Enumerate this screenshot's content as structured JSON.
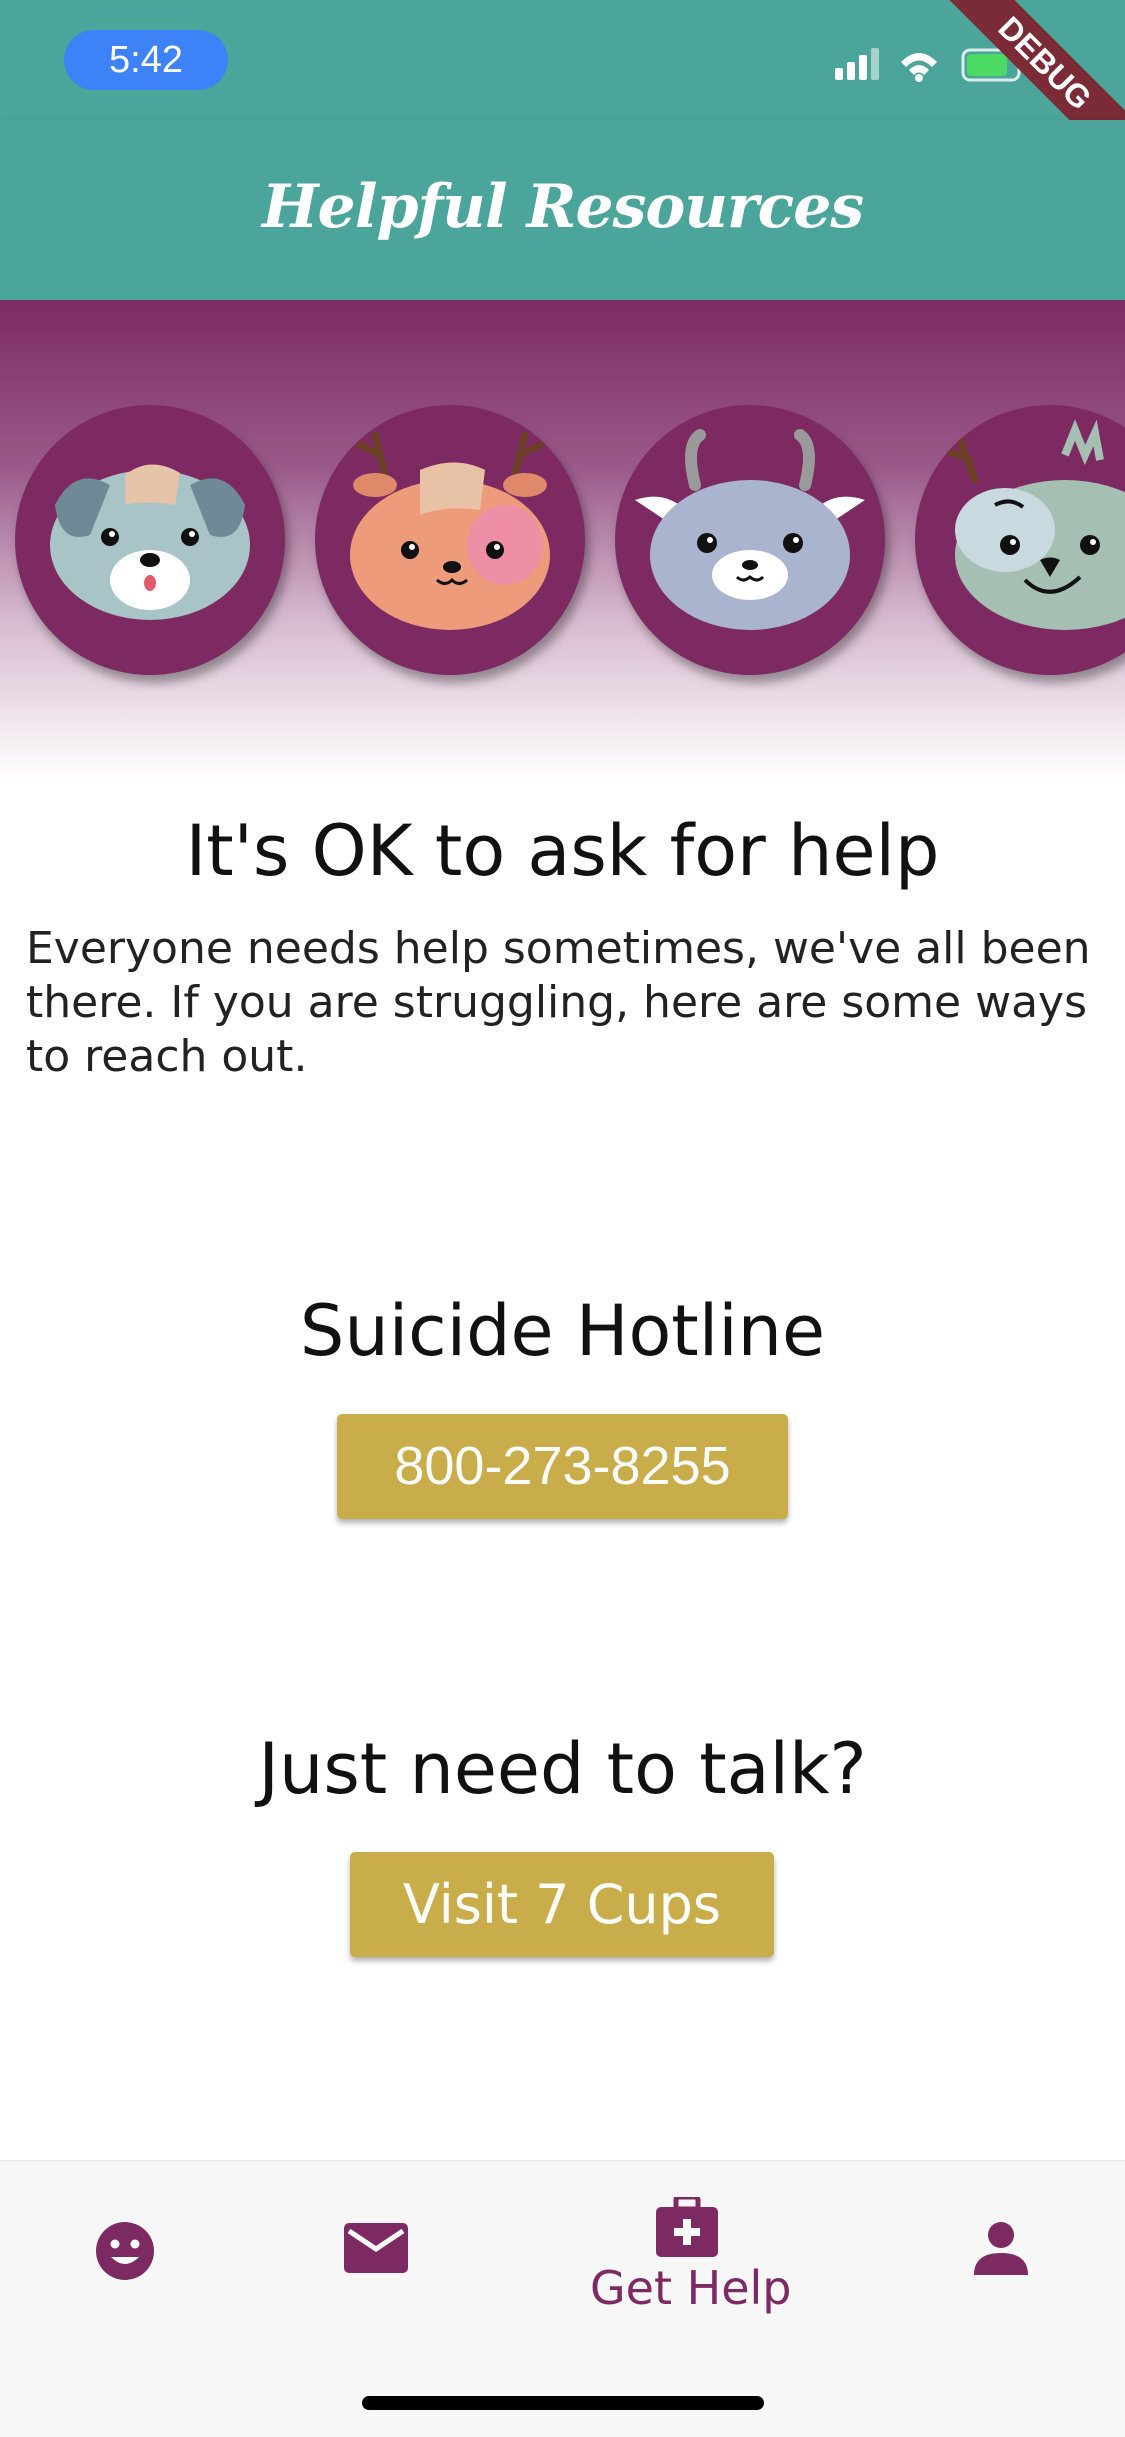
{
  "status_bar": {
    "time": "5:42"
  },
  "debug_banner": "DEBUG",
  "app_bar": {
    "title": "Helpful Resources"
  },
  "avatars": [
    {
      "name": "puppy",
      "face_color": "#a9c4c6"
    },
    {
      "name": "deer",
      "face_color": "#ee9b7b"
    },
    {
      "name": "goat",
      "face_color": "#aab4cf"
    },
    {
      "name": "moose",
      "face_color": "#a5c0b2"
    }
  ],
  "intro": {
    "heading": "It's OK to ask for help",
    "body": "Everyone needs help sometimes, we've all been there. If you are struggling, here are some ways to reach out."
  },
  "hotline": {
    "title": "Suicide Hotline",
    "button": "800-273-8255"
  },
  "talk": {
    "title": "Just need to talk?",
    "button": "Visit 7 Cups"
  },
  "bottom_nav": {
    "items": [
      {
        "icon": "smiley-face-icon"
      },
      {
        "icon": "mail-icon"
      },
      {
        "icon": "medical-kit-icon",
        "label": "Get Help",
        "active": true
      },
      {
        "icon": "person-icon"
      }
    ]
  },
  "colors": {
    "primary_teal": "#4ba59a",
    "brand_purple": "#7d2a63",
    "button_gold": "#c9ad4a"
  }
}
